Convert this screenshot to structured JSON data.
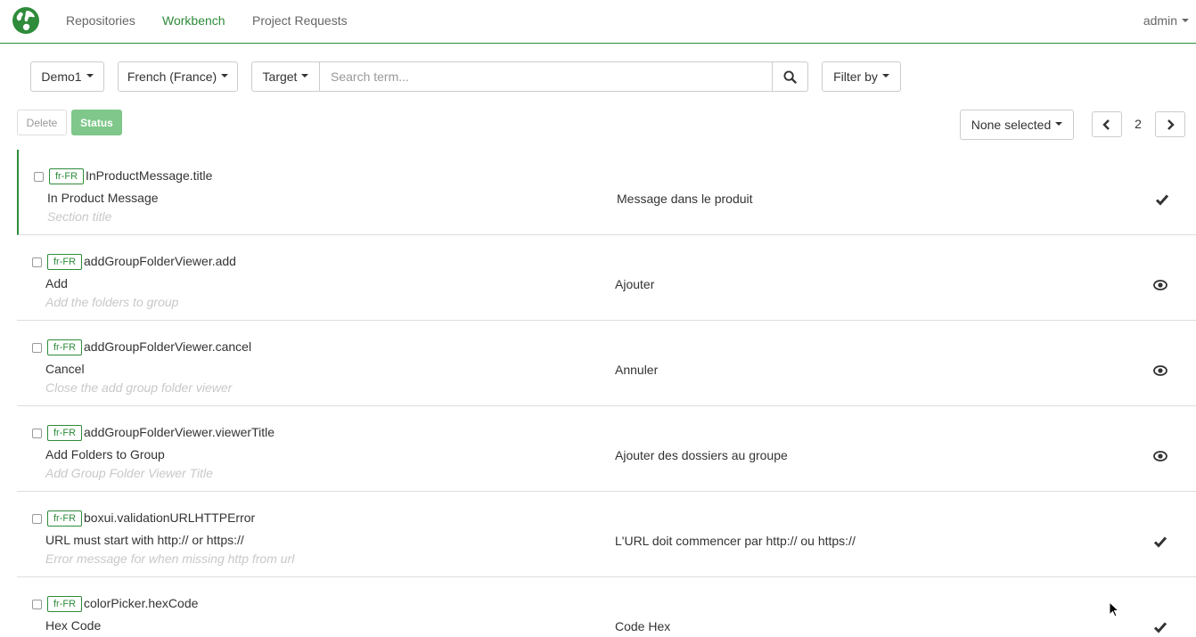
{
  "nav": {
    "links": [
      "Repositories",
      "Workbench",
      "Project Requests"
    ],
    "user": "admin",
    "accent": "#2e8b3a"
  },
  "filters": {
    "repository": "Demo1",
    "locale": "French (France)",
    "target": "Target",
    "search_placeholder": "Search term...",
    "filter_by": "Filter by"
  },
  "actions": {
    "delete": "Delete",
    "status": "Status",
    "selection": "None selected",
    "page": "2"
  },
  "rows": [
    {
      "locale": "fr-FR",
      "key": "InProductMessage.title",
      "source": "In Product Message",
      "comment": "Section title",
      "target": "Message dans le produit",
      "status": "check-icon"
    },
    {
      "locale": "fr-FR",
      "key": "addGroupFolderViewer.add",
      "source": "Add",
      "comment": "Add the folders to group",
      "target": "Ajouter",
      "status": "eye-icon"
    },
    {
      "locale": "fr-FR",
      "key": "addGroupFolderViewer.cancel",
      "source": "Cancel",
      "comment": "Close the add group folder viewer",
      "target": "Annuler",
      "status": "eye-icon"
    },
    {
      "locale": "fr-FR",
      "key": "addGroupFolderViewer.viewerTitle",
      "source": "Add Folders to Group",
      "comment": "Add Group Folder Viewer Title",
      "target": "Ajouter des dossiers au groupe",
      "status": "eye-icon"
    },
    {
      "locale": "fr-FR",
      "key": "boxui.validationURLHTTPError",
      "source": "URL must start with http:// or https://",
      "comment": "Error message for when missing http from url",
      "target": "L'URL doit commencer par http:// ou https://",
      "status": "check-icon"
    },
    {
      "locale": "fr-FR",
      "key": "colorPicker.hexCode",
      "source": "Hex Code",
      "comment": "",
      "target": "Code Hex",
      "status": "check-icon"
    }
  ]
}
